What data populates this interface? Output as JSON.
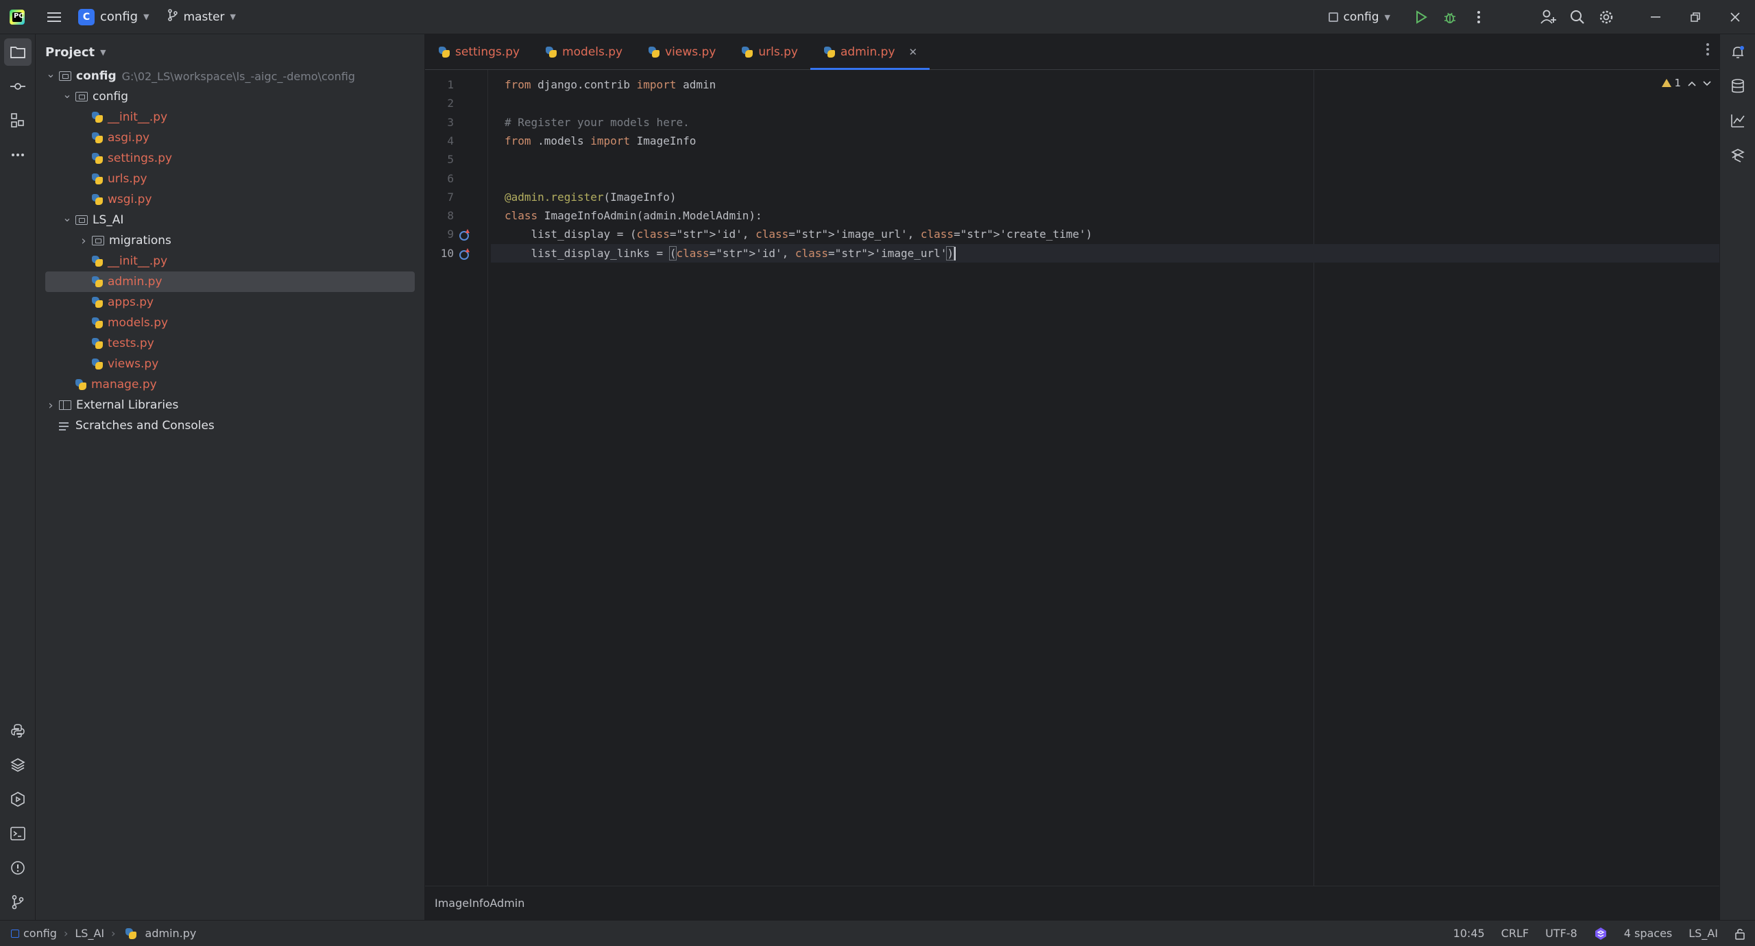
{
  "titlebar": {
    "project_badge": "C",
    "project_name": "config",
    "branch": "master",
    "run_config": "config"
  },
  "project_panel": {
    "title": "Project",
    "tree": [
      {
        "label": "config",
        "path": "G:\\02_LS\\workspace\\ls_-aigc_-demo\\config",
        "depth": 0,
        "kind": "folder",
        "expanded": true
      },
      {
        "label": "config",
        "depth": 1,
        "kind": "folder",
        "expanded": true
      },
      {
        "label": "__init__.py",
        "depth": 2,
        "kind": "py"
      },
      {
        "label": "asgi.py",
        "depth": 2,
        "kind": "py"
      },
      {
        "label": "settings.py",
        "depth": 2,
        "kind": "py"
      },
      {
        "label": "urls.py",
        "depth": 2,
        "kind": "py"
      },
      {
        "label": "wsgi.py",
        "depth": 2,
        "kind": "py"
      },
      {
        "label": "LS_AI",
        "depth": 1,
        "kind": "folder",
        "expanded": true
      },
      {
        "label": "migrations",
        "depth": 2,
        "kind": "folder",
        "expanded": false
      },
      {
        "label": "__init__.py",
        "depth": 2,
        "kind": "py"
      },
      {
        "label": "admin.py",
        "depth": 2,
        "kind": "py",
        "selected": true
      },
      {
        "label": "apps.py",
        "depth": 2,
        "kind": "py"
      },
      {
        "label": "models.py",
        "depth": 2,
        "kind": "py"
      },
      {
        "label": "tests.py",
        "depth": 2,
        "kind": "py"
      },
      {
        "label": "views.py",
        "depth": 2,
        "kind": "py"
      },
      {
        "label": "manage.py",
        "depth": 1,
        "kind": "py"
      },
      {
        "label": "External Libraries",
        "depth": 0,
        "kind": "lib",
        "expanded": false
      },
      {
        "label": "Scratches and Consoles",
        "depth": 0,
        "kind": "scratch"
      }
    ]
  },
  "tabs": [
    {
      "label": "settings.py",
      "active": false
    },
    {
      "label": "models.py",
      "active": false
    },
    {
      "label": "views.py",
      "active": false
    },
    {
      "label": "urls.py",
      "active": false
    },
    {
      "label": "admin.py",
      "active": true
    }
  ],
  "editor": {
    "lines": [
      {
        "n": "1",
        "text": "from django.contrib import admin"
      },
      {
        "n": "2",
        "text": ""
      },
      {
        "n": "3",
        "text": "# Register your models here."
      },
      {
        "n": "4",
        "text": "from .models import ImageInfo"
      },
      {
        "n": "5",
        "text": ""
      },
      {
        "n": "6",
        "text": ""
      },
      {
        "n": "7",
        "text": "@admin.register(ImageInfo)"
      },
      {
        "n": "8",
        "text": "class ImageInfoAdmin(admin.ModelAdmin):"
      },
      {
        "n": "9",
        "text": "    list_display = ('id', 'image_url', 'create_time')"
      },
      {
        "n": "10",
        "text": "    list_display_links = ('id', 'image_url')"
      }
    ],
    "warning_count": "1",
    "breadcrumb": "ImageInfoAdmin"
  },
  "statusbar": {
    "crumbs": [
      "config",
      "LS_AI",
      "admin.py"
    ],
    "position": "10:45",
    "line_sep": "CRLF",
    "encoding": "UTF-8",
    "indent": "4 spaces",
    "interpreter": "LS_AI"
  },
  "colors": {
    "accent": "#3574f0",
    "modified_file": "#e06c57",
    "keyword": "#cf8e6d",
    "string": "#6aab73",
    "comment": "#7a7e85",
    "decorator": "#b3ae60"
  }
}
